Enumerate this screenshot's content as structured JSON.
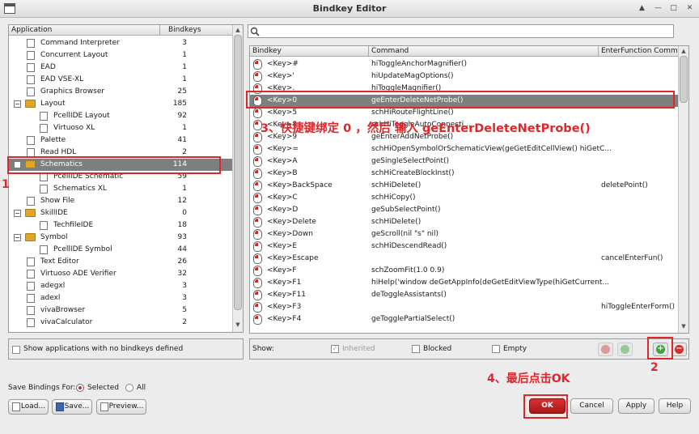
{
  "window": {
    "title": "Bindkey Editor"
  },
  "left_panel": {
    "col_application": "Application",
    "col_bindkeys": "Bindkeys",
    "rows": [
      {
        "name": "Command Interpreter",
        "count": "3",
        "level": 1,
        "type": "file"
      },
      {
        "name": "Concurrent Layout",
        "count": "1",
        "level": 1,
        "type": "file"
      },
      {
        "name": "EAD",
        "count": "1",
        "level": 1,
        "type": "file"
      },
      {
        "name": "EAD VSE-XL",
        "count": "1",
        "level": 1,
        "type": "file"
      },
      {
        "name": "Graphics Browser",
        "count": "25",
        "level": 1,
        "type": "file"
      },
      {
        "name": "Layout",
        "count": "185",
        "level": 1,
        "type": "folder"
      },
      {
        "name": "PcellIDE Layout",
        "count": "92",
        "level": 2,
        "type": "file"
      },
      {
        "name": "Virtuoso XL",
        "count": "1",
        "level": 2,
        "type": "file"
      },
      {
        "name": "Palette",
        "count": "41",
        "level": 1,
        "type": "file"
      },
      {
        "name": "Read HDL",
        "count": "2",
        "level": 1,
        "type": "file"
      },
      {
        "name": "Schematics",
        "count": "114",
        "level": 1,
        "type": "folder",
        "selected": true
      },
      {
        "name": "PcellIDE Schematic",
        "count": "59",
        "level": 2,
        "type": "file"
      },
      {
        "name": "Schematics XL",
        "count": "1",
        "level": 2,
        "type": "file"
      },
      {
        "name": "Show File",
        "count": "12",
        "level": 1,
        "type": "file"
      },
      {
        "name": "SkillIDE",
        "count": "0",
        "level": 1,
        "type": "folder"
      },
      {
        "name": "TechfileIDE",
        "count": "18",
        "level": 2,
        "type": "file"
      },
      {
        "name": "Symbol",
        "count": "93",
        "level": 1,
        "type": "folder"
      },
      {
        "name": "PcellIDE Symbol",
        "count": "44",
        "level": 2,
        "type": "file"
      },
      {
        "name": "Text Editor",
        "count": "26",
        "level": 1,
        "type": "file"
      },
      {
        "name": "Virtuoso ADE Verifier",
        "count": "32",
        "level": 1,
        "type": "file"
      },
      {
        "name": "adegxl",
        "count": "3",
        "level": 1,
        "type": "file"
      },
      {
        "name": "adexl",
        "count": "3",
        "level": 1,
        "type": "file"
      },
      {
        "name": "vivaBrowser",
        "count": "5",
        "level": 1,
        "type": "file"
      },
      {
        "name": "vivaCalculator",
        "count": "2",
        "level": 1,
        "type": "file"
      }
    ],
    "show_no_bindkeys_label": "Show applications with no bindkeys defined"
  },
  "right_panel": {
    "search_placeholder": "",
    "col_bindkey": "Bindkey",
    "col_command": "Command",
    "col_enter": "EnterFunction Comma",
    "rows": [
      {
        "key": "<Key>#",
        "cmd": "hiToggleAnchorMagnifier()",
        "enter": ""
      },
      {
        "key": "<Key>'",
        "cmd": "hiUpdateMagOptions()",
        "enter": ""
      },
      {
        "key": "<Key>.",
        "cmd": "hiToggleMagnifier()",
        "enter": ""
      },
      {
        "key": "<Key>0",
        "cmd": "geEnterDeleteNetProbe()",
        "enter": "",
        "selected": true
      },
      {
        "key": "<Key>5",
        "cmd": "schHiRouteFlightLine()",
        "enter": ""
      },
      {
        "key": "<Key>8",
        "cmd": "schHiToggleAutoConnecti...",
        "enter": ""
      },
      {
        "key": "<Key>9",
        "cmd": "geEnterAddNetProbe()",
        "enter": ""
      },
      {
        "key": "<Key>=",
        "cmd": "schHiOpenSymbolOrSchematicView(geGetEditCellView() hiGetC...",
        "enter": ""
      },
      {
        "key": "<Key>A",
        "cmd": "geSingleSelectPoint()",
        "enter": ""
      },
      {
        "key": "<Key>B",
        "cmd": "schHiCreateBlockInst()",
        "enter": ""
      },
      {
        "key": "<Key>BackSpace",
        "cmd": "schHiDelete()",
        "enter": "deletePoint()"
      },
      {
        "key": "<Key>C",
        "cmd": "schHiCopy()",
        "enter": ""
      },
      {
        "key": "<Key>D",
        "cmd": "geSubSelectPoint()",
        "enter": ""
      },
      {
        "key": "<Key>Delete",
        "cmd": "schHiDelete()",
        "enter": ""
      },
      {
        "key": "<Key>Down",
        "cmd": "geScroll(nil \"s\" nil)",
        "enter": ""
      },
      {
        "key": "<Key>E",
        "cmd": "schHiDescendRead()",
        "enter": ""
      },
      {
        "key": "<Key>Escape",
        "cmd": "",
        "enter": "cancelEnterFun()"
      },
      {
        "key": "<Key>F",
        "cmd": "schZoomFit(1.0 0.9)",
        "enter": ""
      },
      {
        "key": "<Key>F1",
        "cmd": "hiHelp('window deGetAppInfo(deGetEditViewType(hiGetCurrent...",
        "enter": ""
      },
      {
        "key": "<Key>F11",
        "cmd": "deToggleAssistants()",
        "enter": ""
      },
      {
        "key": "<Key>F3",
        "cmd": "",
        "enter": "hiToggleEnterForm()"
      },
      {
        "key": "<Key>F4",
        "cmd": "geTogglePartialSelect()",
        "enter": ""
      }
    ],
    "show_label": "Show:",
    "inherited_label": "Inherited",
    "blocked_label": "Blocked",
    "empty_label": "Empty"
  },
  "bottom": {
    "save_bindings_label": "Save Bindings For:",
    "selected_label": "Selected",
    "all_label": "All",
    "load_label": "Load...",
    "save_label": "Save...",
    "preview_label": "Preview...",
    "ok_label": "OK",
    "cancel_label": "Cancel",
    "apply_label": "Apply",
    "help_label": "Help"
  },
  "annotations": {
    "step1": "1",
    "step2": "2",
    "step3": "3、快捷键绑定 0 ，然后 输入 geEnterDeleteNetProbe()",
    "step4": "4、最后点击OK"
  },
  "colors": {
    "annotation": "#e0262a",
    "selection": "#7f7f7f",
    "add_button": "#3aa43a",
    "remove_button": "#d0302a"
  }
}
